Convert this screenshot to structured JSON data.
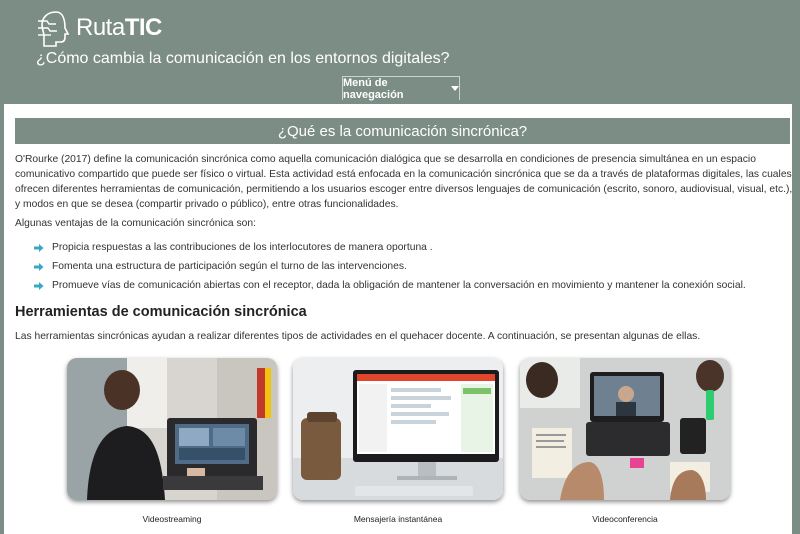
{
  "header": {
    "brand_prefix": "Ruta",
    "brand_suffix": "TIC",
    "subtitle": "¿Cómo cambia la comunicación en los entornos digitales?",
    "nav_button_label": "Menú de navegación"
  },
  "section": {
    "title": "¿Qué es la comunicación sincrónica?",
    "paragraph": "O'Rourke (2017) define la comunicación sincrónica como aquella comunicación dialógica que se desarrolla en condiciones de presencia simultánea en un espacio comunicativo compartido que puede ser físico o virtual. Esta actividad está enfocada en la comunicación sincrónica que se da a través de plataformas digitales, las cuales ofrecen diferentes herramientas de comunicación, permitiendo a los usuarios escoger entre diversos lenguajes de comunicación (escrito, sonoro, audiovisual, visual, etc.), y modos en que se desea (compartir privado o público), entre otras funcionalidades.",
    "advantages_intro": "Algunas ventajas de la comunicación sincrónica son:",
    "advantages": [
      "Propicia respuestas a las contribuciones de los interlocutores de manera oportuna .",
      "Fomenta una estructura de participación según el turno de las intervenciones.",
      "Promueve vías de comunicación abiertas con el receptor, dada la obligación de mantener la conversación en movimiento y mantener la conexión social."
    ]
  },
  "tools": {
    "heading": "Herramientas de comunicación sincrónica",
    "intro": "Las herramientas sincrónicas ayudan a realizar diferentes tipos de actividades en el quehacer docente. A continuación, se presentan algunas de ellas.",
    "cards": [
      {
        "caption": "Videostreaming"
      },
      {
        "caption": "Mensajería instantánea"
      },
      {
        "caption": "Videoconferencia"
      }
    ]
  },
  "colors": {
    "header_bg": "#7c8d85",
    "bullet_arrow": "#3aa7c2"
  }
}
